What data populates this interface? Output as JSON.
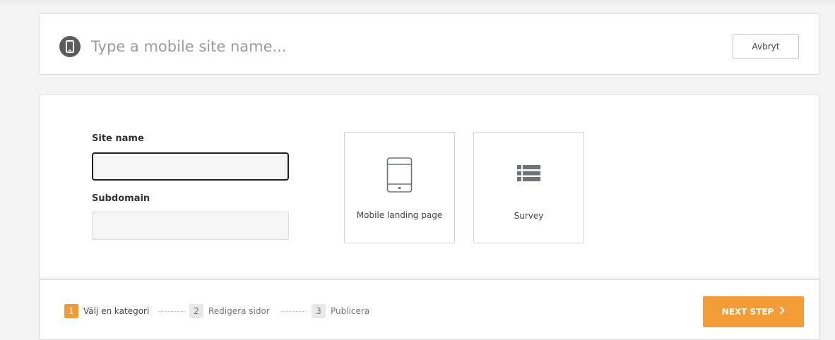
{
  "header": {
    "site_name_placeholder": "Type a mobile site name...",
    "cancel_label": "Avbryt",
    "phone_icon": "mobile-phone-icon"
  },
  "form": {
    "site_name_label": "Site name",
    "site_name_value": "",
    "subdomain_label": "Subdomain",
    "subdomain_value": ""
  },
  "categories": [
    {
      "label": "Mobile landing page",
      "icon": "tablet-icon"
    },
    {
      "label": "Survey",
      "icon": "list-icon"
    }
  ],
  "steps": [
    {
      "num": "1",
      "label": "Välj en kategori",
      "active": true
    },
    {
      "num": "2",
      "label": "Redigera sidor",
      "active": false
    },
    {
      "num": "3",
      "label": "Publicera",
      "active": false
    }
  ],
  "footer": {
    "next_label": "NEXT STEP",
    "next_icon": "chevron-right-icon"
  },
  "colors": {
    "accent": "#f39c35",
    "badge": "#5c5c5c",
    "icon": "#6f7377"
  }
}
